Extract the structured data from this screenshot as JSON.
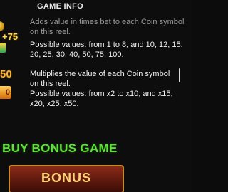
{
  "header": {
    "title": "GAME INFO"
  },
  "coin_symbol": {
    "icon_value": "+75",
    "description": "Adds value in times bet to each Coin symbol on this reel.",
    "possible_values": "Possible values: from 1 to 8, and 10, 12, 15, 20, 25, 30, 40, 50, 75, 100."
  },
  "multiplier_symbol": {
    "icon_value": "50",
    "multiplier_badge": "0",
    "description": "Multiplies the value of each Coin symbol on this reel.",
    "possible_values": "Possible values: from x2 to x10, and x15, x20, x25, x50."
  },
  "buy_bonus": {
    "title": "BUY BONUS GAME",
    "button_label": "BONUS"
  },
  "icons": {
    "coin": "gold-coin-icon",
    "green": "green-symbol-icon",
    "multiplier": "multiplier-icon"
  }
}
